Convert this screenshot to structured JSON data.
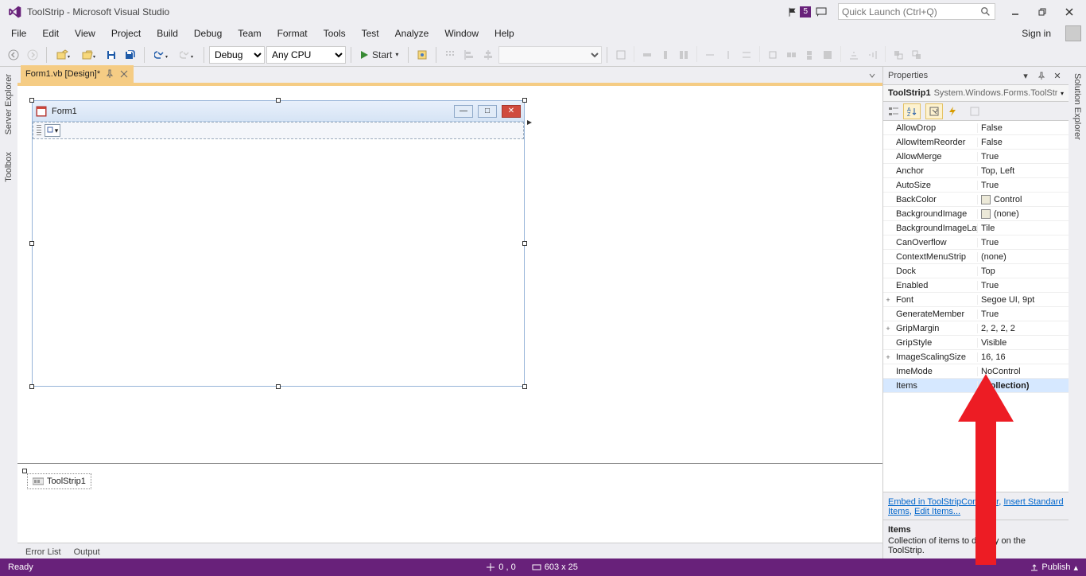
{
  "title": "ToolStrip - Microsoft Visual Studio",
  "quicklaunch_placeholder": "Quick Launch (Ctrl+Q)",
  "notif_count": "5",
  "signin": "Sign in",
  "menu": [
    "File",
    "Edit",
    "View",
    "Project",
    "Build",
    "Debug",
    "Team",
    "Format",
    "Tools",
    "Test",
    "Analyze",
    "Window",
    "Help"
  ],
  "config": "Debug",
  "platform": "Any CPU",
  "start": "Start",
  "left_tabs": [
    "Server Explorer",
    "Toolbox"
  ],
  "right_tabs": [
    "Solution Explorer"
  ],
  "doc_tab": "Form1.vb [Design]*",
  "form_title": "Form1",
  "tray_item": "ToolStrip1",
  "bottom_tabs": [
    "Error List",
    "Output"
  ],
  "props": {
    "header": "Properties",
    "obj_name": "ToolStrip1",
    "obj_type": "System.Windows.Forms.ToolStrip",
    "rows": [
      {
        "exp": "",
        "k": "AllowDrop",
        "v": "False"
      },
      {
        "exp": "",
        "k": "AllowItemReorder",
        "v": "False"
      },
      {
        "exp": "",
        "k": "AllowMerge",
        "v": "True"
      },
      {
        "exp": "",
        "k": "Anchor",
        "v": "Top, Left"
      },
      {
        "exp": "",
        "k": "AutoSize",
        "v": "True"
      },
      {
        "exp": "",
        "k": "BackColor",
        "v": "Control",
        "swatch": true
      },
      {
        "exp": "",
        "k": "BackgroundImage",
        "v": "(none)",
        "swatch": true
      },
      {
        "exp": "",
        "k": "BackgroundImageLayout",
        "v": "Tile"
      },
      {
        "exp": "",
        "k": "CanOverflow",
        "v": "True"
      },
      {
        "exp": "",
        "k": "ContextMenuStrip",
        "v": "(none)"
      },
      {
        "exp": "",
        "k": "Dock",
        "v": "Top"
      },
      {
        "exp": "",
        "k": "Enabled",
        "v": "True"
      },
      {
        "exp": "+",
        "k": "Font",
        "v": "Segoe UI, 9pt"
      },
      {
        "exp": "",
        "k": "GenerateMember",
        "v": "True"
      },
      {
        "exp": "+",
        "k": "GripMargin",
        "v": "2, 2, 2, 2"
      },
      {
        "exp": "",
        "k": "GripStyle",
        "v": "Visible"
      },
      {
        "exp": "+",
        "k": "ImageScalingSize",
        "v": "16, 16"
      },
      {
        "exp": "",
        "k": "ImeMode",
        "v": "NoControl"
      },
      {
        "exp": "",
        "k": "Items",
        "v": "(Collection)",
        "sel": true
      }
    ],
    "link1": "Embed in ToolStripContainer",
    "link2": "Insert Standard Items",
    "link3": "Edit Items...",
    "desc_title": "Items",
    "desc_text": "Collection of items to display on the ToolStrip."
  },
  "status": {
    "ready": "Ready",
    "pos": "0 , 0",
    "size": "603 x 25",
    "publish": "Publish"
  }
}
